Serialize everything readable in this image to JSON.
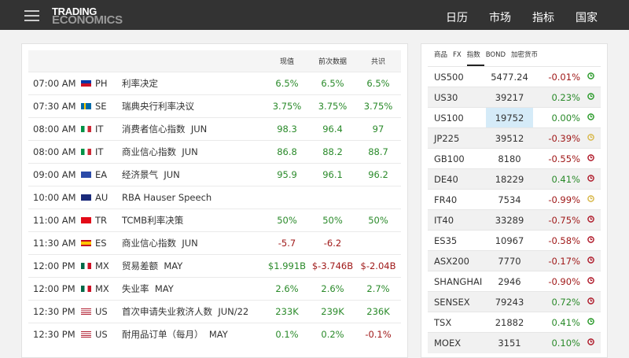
{
  "header": {
    "logo_top": "TRADING",
    "logo_bottom": "ECONOMICS",
    "nav": [
      "日历",
      "市场",
      "指标",
      "国家"
    ]
  },
  "calendar": {
    "columns": {
      "actual": "现值",
      "previous": "前次数据",
      "consensus": "共识"
    },
    "rows": [
      {
        "time": "07:00 AM",
        "country": "PH",
        "event": "利率决定",
        "ref": "",
        "actual": "6.5%",
        "previous": "6.5%",
        "consensus": "6.5%",
        "ac": "up",
        "pc": "up",
        "cc": "up"
      },
      {
        "time": "07:30 AM",
        "country": "SE",
        "event": "瑞典央行利率决议",
        "ref": "",
        "actual": "3.75%",
        "previous": "3.75%",
        "consensus": "3.75%",
        "ac": "up",
        "pc": "up",
        "cc": "up"
      },
      {
        "time": "08:00 AM",
        "country": "IT",
        "event": "消费者信心指数",
        "ref": "JUN",
        "actual": "98.3",
        "previous": "96.4",
        "consensus": "97",
        "ac": "up",
        "pc": "up",
        "cc": "up"
      },
      {
        "time": "08:00 AM",
        "country": "IT",
        "event": "商业信心指数",
        "ref": "JUN",
        "actual": "86.8",
        "previous": "88.2",
        "consensus": "88.7",
        "ac": "up",
        "pc": "up",
        "cc": "up"
      },
      {
        "time": "09:00 AM",
        "country": "EA",
        "event": "经济景气",
        "ref": "JUN",
        "actual": "95.9",
        "previous": "96.1",
        "consensus": "96.2",
        "ac": "up",
        "pc": "up",
        "cc": "up"
      },
      {
        "time": "10:00 AM",
        "country": "AU",
        "event": "RBA Hauser Speech",
        "ref": "",
        "actual": "",
        "previous": "",
        "consensus": "",
        "ac": "up",
        "pc": "up",
        "cc": "up"
      },
      {
        "time": "11:00 AM",
        "country": "TR",
        "event": "TCMB利率决策",
        "ref": "",
        "actual": "50%",
        "previous": "50%",
        "consensus": "50%",
        "ac": "up",
        "pc": "up",
        "cc": "up"
      },
      {
        "time": "11:30 AM",
        "country": "ES",
        "event": "商业信心指数",
        "ref": "JUN",
        "actual": "-5.7",
        "previous": "-6.2",
        "consensus": "",
        "ac": "dn",
        "pc": "dn",
        "cc": "dn"
      },
      {
        "time": "12:00 PM",
        "country": "MX",
        "event": "贸易差额",
        "ref": "MAY",
        "actual": "$1.991B",
        "previous": "$-3.746B",
        "consensus": "$-2.04B",
        "ac": "up",
        "pc": "dn",
        "cc": "dn"
      },
      {
        "time": "12:00 PM",
        "country": "MX",
        "event": "失业率",
        "ref": "MAY",
        "actual": "2.6%",
        "previous": "2.6%",
        "consensus": "2.7%",
        "ac": "up",
        "pc": "up",
        "cc": "up"
      },
      {
        "time": "12:30 PM",
        "country": "US",
        "event": "首次申请失业救济人数",
        "ref": "JUN/22",
        "actual": "233K",
        "previous": "239K",
        "consensus": "236K",
        "ac": "up",
        "pc": "up",
        "cc": "up"
      },
      {
        "time": "12:30 PM",
        "country": "US",
        "event": "耐用品订单（每月）",
        "ref": "MAY",
        "actual": "0.1%",
        "previous": "0.2%",
        "consensus": "-0.1%",
        "ac": "up",
        "pc": "up",
        "cc": "dn"
      }
    ]
  },
  "flags": {
    "PH": "linear-gradient(#0038a8 50%,#ce1126 50%)",
    "SE": "linear-gradient(90deg,#006aa7 30%,#fecc00 30%,#fecc00 45%,#006aa7 45%)",
    "IT": "linear-gradient(90deg,#009246 33%,#fff 33%,#fff 66%,#ce2b37 66%)",
    "EA": "#2a4aa8",
    "AU": "#1a2a7a",
    "TR": "#e30a17",
    "ES": "linear-gradient(#c60b1e 25%,#ffc400 25%,#ffc400 75%,#c60b1e 75%)",
    "MX": "linear-gradient(90deg,#006847 33%,#fff 33%,#fff 66%,#ce1126 66%)",
    "US": "repeating-linear-gradient(#b22234 0 1.2px,#fff 1.2px 2.4px)"
  },
  "colors": {
    "up": "#2a8a2a",
    "down": "#a01a1a",
    "clock_green": "#2a9a2a",
    "clock_yellow": "#d8b84a",
    "clock_red": "#b01a2a"
  },
  "markets": {
    "tabs": [
      "商品",
      "FX",
      "指数",
      "BOND",
      "加密货币"
    ],
    "active_tab": "指数",
    "rows": [
      {
        "name": "US500",
        "price": "5477.24",
        "change": "-0.01%",
        "dir": "dn",
        "clock": "green"
      },
      {
        "name": "US30",
        "price": "39217",
        "change": "0.23%",
        "dir": "up",
        "clock": "green"
      },
      {
        "name": "US100",
        "price": "19752",
        "change": "0.00%",
        "dir": "up",
        "clock": "green",
        "highlight": true
      },
      {
        "name": "JP225",
        "price": "39512",
        "change": "-0.39%",
        "dir": "dn",
        "clock": "yellow"
      },
      {
        "name": "GB100",
        "price": "8180",
        "change": "-0.55%",
        "dir": "dn",
        "clock": "red"
      },
      {
        "name": "DE40",
        "price": "18229",
        "change": "0.41%",
        "dir": "up",
        "clock": "red"
      },
      {
        "name": "FR40",
        "price": "7534",
        "change": "-0.99%",
        "dir": "dn",
        "clock": "yellow"
      },
      {
        "name": "IT40",
        "price": "33289",
        "change": "-0.75%",
        "dir": "dn",
        "clock": "red"
      },
      {
        "name": "ES35",
        "price": "10967",
        "change": "-0.58%",
        "dir": "dn",
        "clock": "red"
      },
      {
        "name": "ASX200",
        "price": "7770",
        "change": "-0.17%",
        "dir": "dn",
        "clock": "red"
      },
      {
        "name": "SHANGHAI",
        "price": "2946",
        "change": "-0.90%",
        "dir": "dn",
        "clock": "red"
      },
      {
        "name": "SENSEX",
        "price": "79243",
        "change": "0.72%",
        "dir": "up",
        "clock": "red"
      },
      {
        "name": "TSX",
        "price": "21882",
        "change": "0.41%",
        "dir": "up",
        "clock": "green"
      },
      {
        "name": "MOEX",
        "price": "3151",
        "change": "0.10%",
        "dir": "up",
        "clock": "red"
      }
    ]
  }
}
